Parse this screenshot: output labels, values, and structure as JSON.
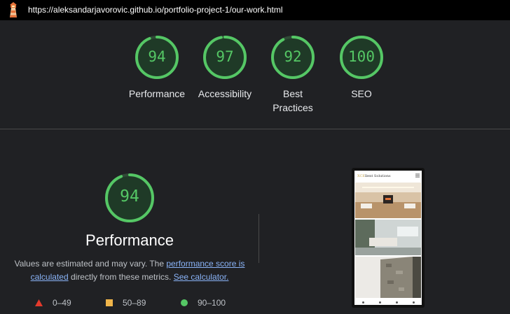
{
  "topbar": {
    "url": "https://aleksandarjavorovic.github.io/portfolio-project-1/our-work.html",
    "logo_icon": "lighthouse-icon"
  },
  "gauges": [
    {
      "score": 94,
      "value": "94",
      "label": "Performance",
      "color": "#55c765"
    },
    {
      "score": 97,
      "value": "97",
      "label": "Accessibility",
      "color": "#55c765"
    },
    {
      "score": 92,
      "value": "92",
      "label": "Best Practices",
      "color": "#55c765"
    },
    {
      "score": 100,
      "value": "100",
      "label": "SEO",
      "color": "#55c765"
    }
  ],
  "performance": {
    "score": 94,
    "value": "94",
    "title": "Performance",
    "desc_prefix": "Values are estimated and may vary. The ",
    "desc_link1": "performance score is calculated",
    "desc_middle": " directly from these metrics. ",
    "desc_link2": "See calculator."
  },
  "legend": [
    {
      "range": "0–49",
      "icon": "triangle-icon",
      "color": "#e33a2c"
    },
    {
      "range": "50–89",
      "icon": "square-icon",
      "color": "#f0b54a"
    },
    {
      "range": "90–100",
      "icon": "circle-icon",
      "color": "#55c765"
    }
  ],
  "screenshot": {
    "site_name_accent": "XCE",
    "site_name_rest": "llent Solutions"
  },
  "colors": {
    "background": "#202124",
    "pass": "#55c765",
    "link": "#8ab4f8"
  }
}
